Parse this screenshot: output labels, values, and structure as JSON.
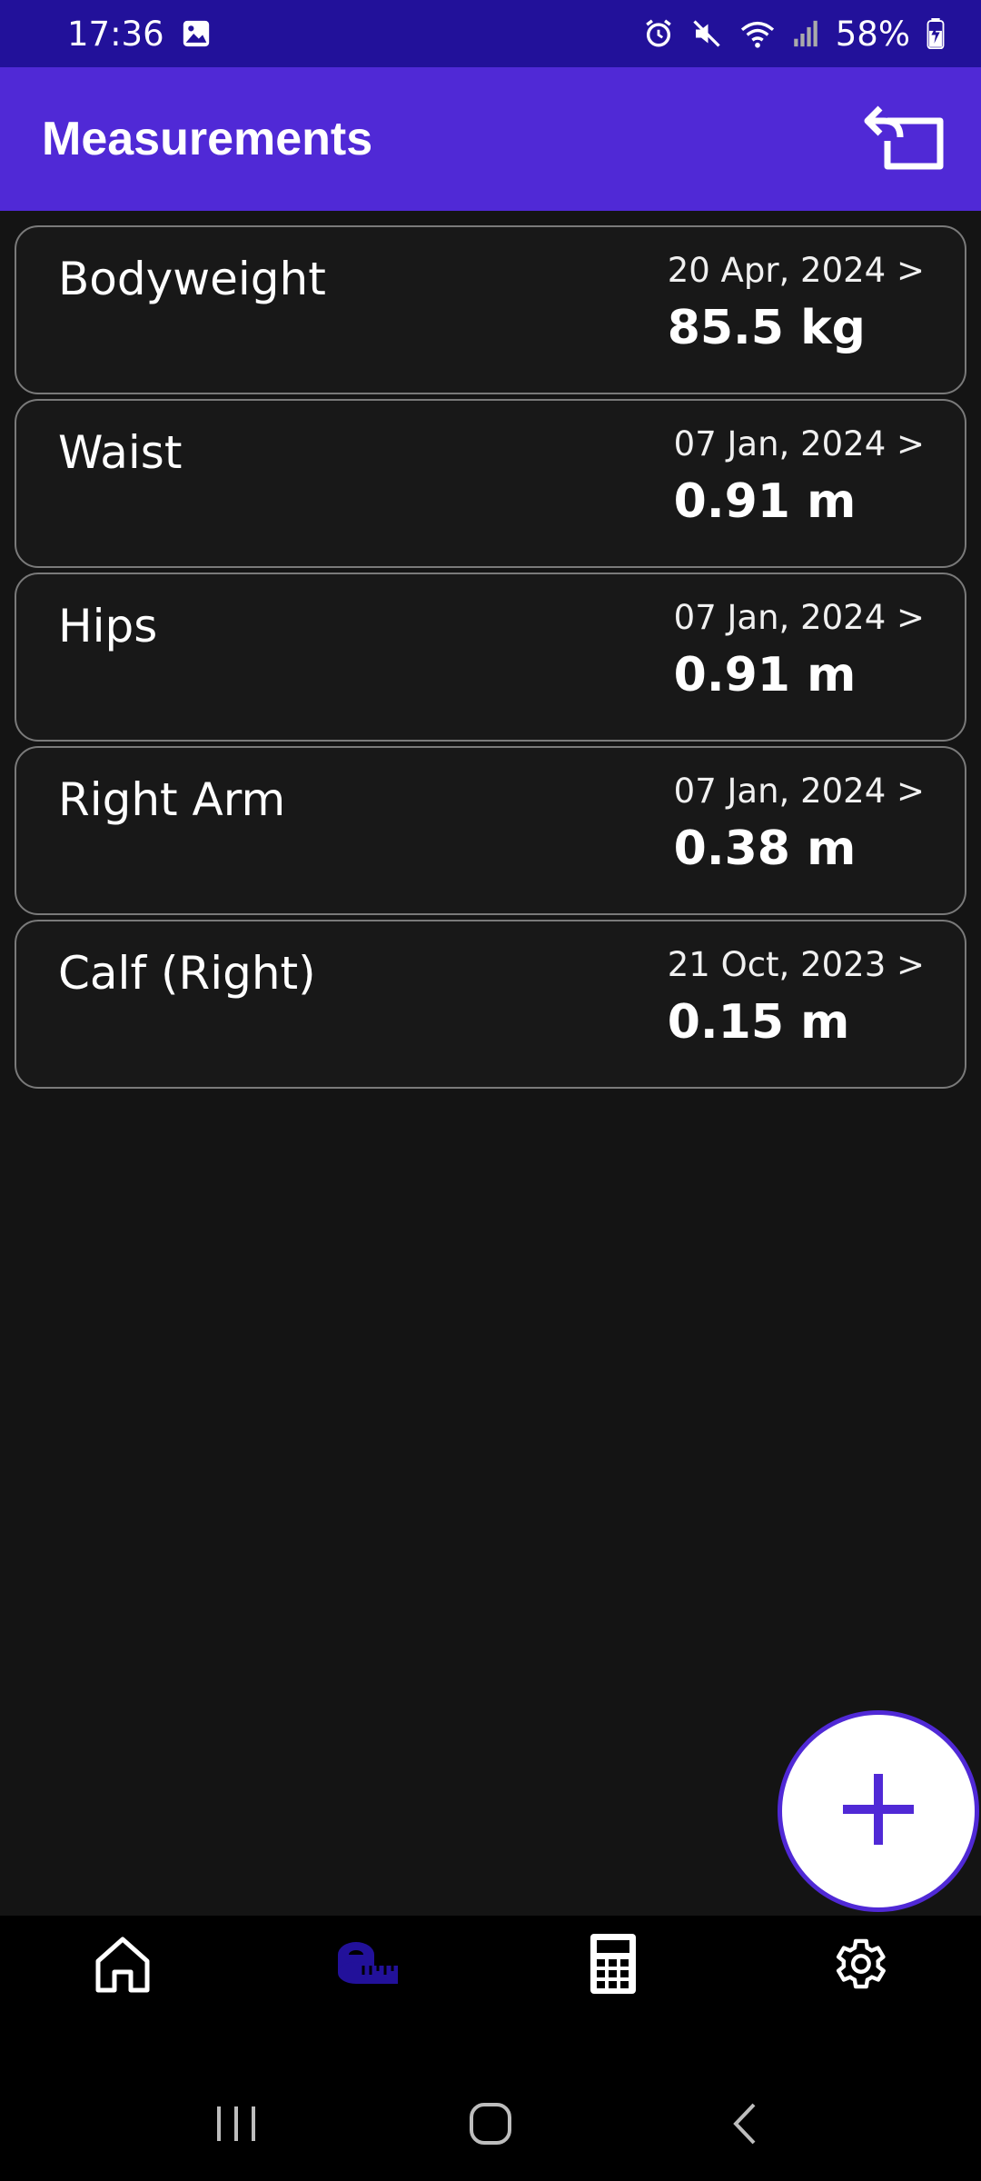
{
  "status_bar": {
    "time": "17:36",
    "battery": "58%",
    "icons": [
      "gallery-icon",
      "alarm-icon",
      "mute-icon",
      "wifi-icon",
      "signal-icon",
      "battery-charging-icon"
    ]
  },
  "app_bar": {
    "title": "Measurements",
    "action_icon": "export-icon"
  },
  "measurements": [
    {
      "name": "Bodyweight",
      "date": "20 Apr, 2024 >",
      "value": "85.5 kg"
    },
    {
      "name": "Waist",
      "date": "07 Jan, 2024 >",
      "value": "0.91 m"
    },
    {
      "name": "Hips",
      "date": "07 Jan, 2024 >",
      "value": "0.91 m"
    },
    {
      "name": "Right Arm",
      "date": "07 Jan, 2024 >",
      "value": "0.38 m"
    },
    {
      "name": "Calf (Right)",
      "date": "21 Oct, 2023 >",
      "value": "0.15 m"
    }
  ],
  "fab": {
    "icon": "plus-icon"
  },
  "bottom_nav": [
    {
      "icon": "home-icon",
      "active": false
    },
    {
      "icon": "measuring-tape-icon",
      "active": true
    },
    {
      "icon": "calculator-icon",
      "active": false
    },
    {
      "icon": "gear-icon",
      "active": false
    }
  ],
  "system_nav": [
    "recents-icon",
    "home-circle-icon",
    "back-icon"
  ],
  "colors": {
    "status_bar": "#22119a",
    "app_bar": "#5029d6",
    "background": "#141414",
    "accent": "#5029d6"
  }
}
